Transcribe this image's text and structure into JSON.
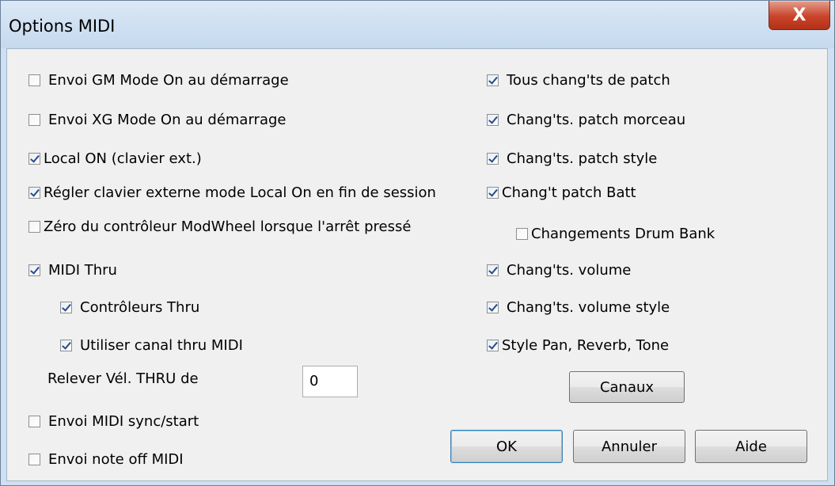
{
  "window": {
    "title": "Options MIDI",
    "close_label": "X"
  },
  "left": [
    {
      "label": "Envoi GM Mode On au démarrage",
      "checked": false
    },
    {
      "label": "Envoi XG Mode On au démarrage",
      "checked": false
    },
    {
      "label": "Local ON (clavier ext.)",
      "checked": true
    },
    {
      "label": "Régler clavier externe mode Local On en fin de session",
      "checked": true
    },
    {
      "label": "Zéro du contrôleur ModWheel lorsque l'arrêt pressé",
      "checked": false
    },
    {
      "label": "MIDI Thru",
      "checked": true
    },
    {
      "label": "Contrôleurs Thru",
      "checked": true
    },
    {
      "label": "Utiliser canal thru MIDI",
      "checked": true
    },
    {
      "label": "Envoi MIDI sync/start",
      "checked": false
    },
    {
      "label": "Envoi note off MIDI",
      "checked": false
    }
  ],
  "velocity": {
    "label": "Relever Vél. THRU de",
    "value": "0"
  },
  "right": [
    {
      "label": "Tous chang'ts de patch",
      "checked": true
    },
    {
      "label": "Chang'ts. patch morceau",
      "checked": true
    },
    {
      "label": "Chang'ts. patch style",
      "checked": true
    },
    {
      "label": "Chang't patch Batt",
      "checked": true
    },
    {
      "label": "Changements Drum Bank",
      "checked": false
    },
    {
      "label": "Chang'ts. volume",
      "checked": true
    },
    {
      "label": "Chang'ts. volume style",
      "checked": true
    },
    {
      "label": "Style Pan, Reverb, Tone",
      "checked": true
    }
  ],
  "buttons": {
    "channels": "Canaux",
    "ok": "OK",
    "cancel": "Annuler",
    "help": "Aide"
  }
}
